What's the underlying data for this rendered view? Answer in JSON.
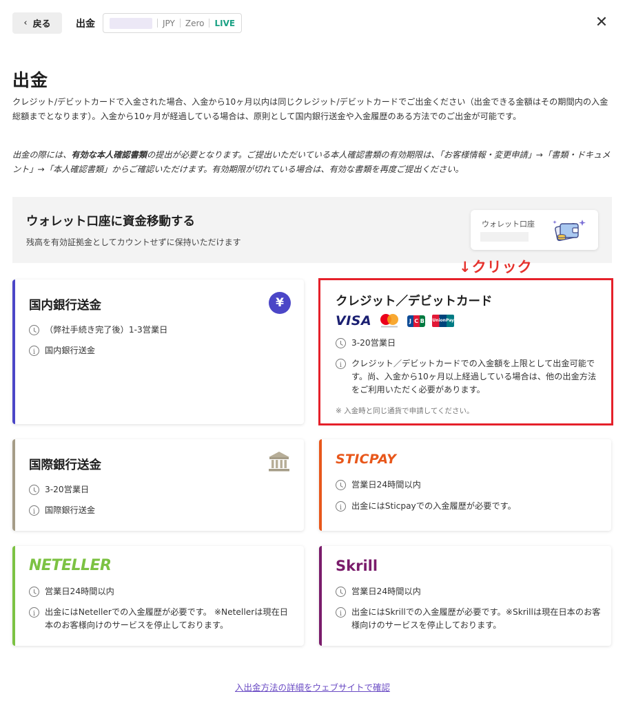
{
  "topbar": {
    "back_label": "戻る",
    "title": "出金",
    "account_currency": "JPY",
    "account_type": "Zero",
    "account_mode": "LIVE",
    "close_icon": "close-icon"
  },
  "page": {
    "title": "出金",
    "description": "クレジット/デビットカードで入金された場合、入金から10ヶ月以内は同じクレジット/デビットカードでご出金ください（出金できる金額はその期間内の入金総額までとなります）。入金から10ヶ月が経過している場合は、原則として国内銀行送金や入金履歴のある方法でのご出金が可能です。",
    "note_pre": "出金の際には、",
    "note_bold": "有効な本人確認書類",
    "note_post": "の提出が必要となります。ご提出いただいている本人確認書類の有効期限は、「お客様情報・変更申請」→「書類・ドキュメント」→「本人確認書類」からご確認いただけます。有効期限が切れている場合は、有効な書類を再度ご提出ください。"
  },
  "wallet": {
    "title": "ウォレット口座に資金移動する",
    "subtitle": "残高を有効証拠金としてカウントせずに保持いただけます",
    "card_label": "ウォレット口座"
  },
  "annotation": "↓クリック",
  "methods": {
    "domestic": {
      "title": "国内銀行送金",
      "time": "（弊社手続き完了後）1-3営業日",
      "info": "国内銀行送金",
      "badge": "¥"
    },
    "card": {
      "title": "クレジット／デビットカード",
      "brands": {
        "visa": "VISA",
        "jcb": "JCB",
        "unionpay": "UnionPay"
      },
      "time": "3-20営業日",
      "info": "クレジット／デビットカードでの入金額を上限として出金可能です。尚、入金から10ヶ月以上経過している場合は、他の出金方法をご利用いただく必要があります。",
      "note": "※ 入金時と同じ通貨で申請してください。"
    },
    "international": {
      "title": "国際銀行送金",
      "time": "3-20営業日",
      "info": "国際銀行送金"
    },
    "sticpay": {
      "brand": "STICPAY",
      "time": "営業日24時間以内",
      "info": "出金にはSticpayでの入金履歴が必要です。"
    },
    "neteller": {
      "brand": "NETELLER",
      "time": "営業日24時間以内",
      "info": "出金にはNetellerでの入金履歴が必要です。 ※Netellerは現在日本のお客様向けのサービスを停止しております。"
    },
    "skrill": {
      "brand": "Skrill",
      "time": "営業日24時間以内",
      "info": "出金にはSkrillでの入金履歴が必要です。※Skrillは現在日本のお客様向けのサービスを停止しております。"
    }
  },
  "footer": {
    "link": "入出金方法の詳細をウェブサイトで確認"
  },
  "colors": {
    "domestic_bar": "#4b46c7",
    "international_bar": "#a59c87",
    "sticpay_bar": "#e8571b",
    "neteller_bar": "#7cc243",
    "skrill_bar": "#7a1c6b",
    "highlight": "#e5202a",
    "live": "#1aa184"
  }
}
